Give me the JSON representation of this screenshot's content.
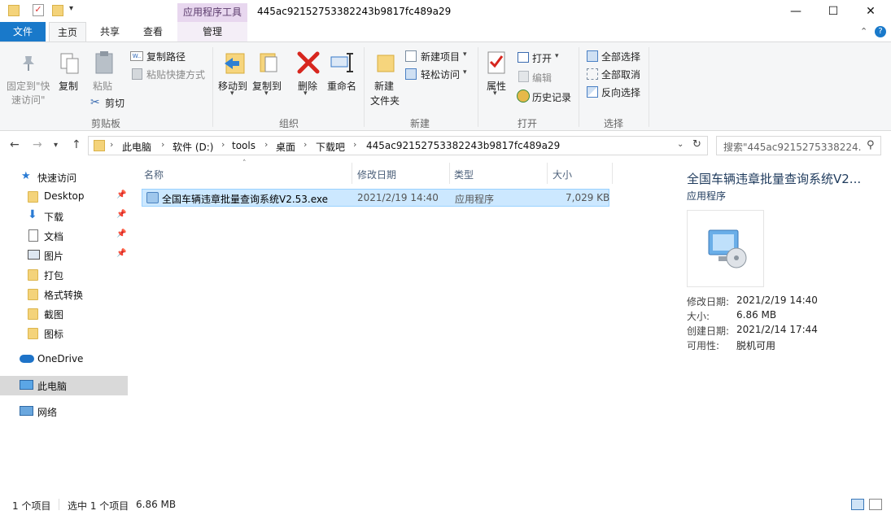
{
  "titlebar": {
    "context_tab_header": "应用程序工具",
    "title": "445ac92152753382243b9817fc489a29",
    "minimize": "—",
    "maximize": "☐",
    "close": "✕"
  },
  "ribbon_tabs": {
    "file": "文件",
    "home": "主页",
    "share": "共享",
    "view": "查看",
    "manage": "管理"
  },
  "clipboard": {
    "pin_line1": "固定到\"快",
    "pin_line2": "速访问\"",
    "copy": "复制",
    "paste": "粘贴",
    "copy_path": "复制路径",
    "paste_shortcut": "粘贴快捷方式",
    "cut": "剪切",
    "group": "剪贴板"
  },
  "organize": {
    "move_to": "移动到",
    "copy_to": "复制到",
    "delete": "删除",
    "rename": "重命名",
    "group": "组织"
  },
  "new": {
    "new_item": "新建项目",
    "easy_access": "轻松访问",
    "new_folder_line1": "新建",
    "new_folder_line2": "文件夹",
    "group": "新建"
  },
  "open": {
    "properties": "属性",
    "open": "打开",
    "edit": "编辑",
    "history": "历史记录",
    "group": "打开"
  },
  "select": {
    "select_all": "全部选择",
    "select_none": "全部取消",
    "invert": "反向选择",
    "group": "选择"
  },
  "address": {
    "crumbs": [
      "此电脑",
      "软件 (D:)",
      "tools",
      "桌面",
      "下载吧",
      "445ac92152753382243b9817fc489a29"
    ],
    "search_placeholder": "搜索\"445ac9215275338224..."
  },
  "nav": {
    "quick_access": "快速访问",
    "items": [
      "Desktop",
      "下载",
      "文档",
      "图片",
      "打包",
      "格式转换",
      "截图",
      "图标"
    ],
    "onedrive": "OneDrive",
    "this_pc": "此电脑",
    "network": "网络"
  },
  "columns": {
    "name": "名称",
    "modified": "修改日期",
    "type": "类型",
    "size": "大小"
  },
  "files": [
    {
      "name": "全国车辆违章批量查询系统V2.53.exe",
      "modified": "2021/2/19 14:40",
      "type": "应用程序",
      "size": "7,029 KB"
    }
  ],
  "details": {
    "title": "全国车辆违章批量查询系统V2...",
    "subtitle": "应用程序",
    "modified_label": "修改日期:",
    "modified": "2021/2/19 14:40",
    "size_label": "大小:",
    "size": "6.86 MB",
    "created_label": "创建日期:",
    "created": "2021/2/14 17:44",
    "availability_label": "可用性:",
    "availability": "脱机可用"
  },
  "status": {
    "count": "1 个项目",
    "selected": "选中 1 个项目",
    "selected_size": "6.86 MB"
  },
  "colors": {
    "accent": "#1979ca",
    "selection": "#cce8ff",
    "context_tab": "#e8d7ef"
  }
}
